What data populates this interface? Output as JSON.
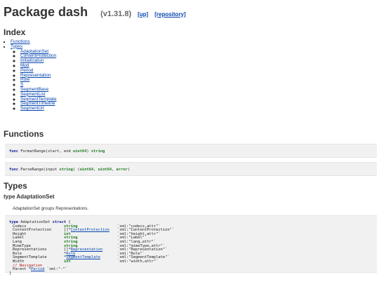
{
  "header": {
    "title": "Package dash",
    "version": "(v1.31.8)",
    "up_link": "[up]",
    "repo_link": "[repository]"
  },
  "index": {
    "heading": "Index",
    "functions_link": "Functions",
    "types_link": "Types",
    "types": [
      "AdaptationSet",
      "ContentProtection",
      "Initialization",
      "Mpd",
      "Period",
      "Representation",
      "Role",
      "S",
      "SegmentBase",
      "SegmentList",
      "SegmentTemplate",
      "SegmentTimeline",
      "SegmentUrl"
    ]
  },
  "functions": {
    "heading": "Functions",
    "format_range": {
      "kw": "func",
      "sig": " FormatRange(start, end ",
      "ptype": "uint64",
      "mid": ") ",
      "rtype": "string"
    },
    "parse_range": {
      "kw": "func",
      "sig": " ParseRange(input ",
      "ptype": "string",
      "mid": ") (",
      "r1": "uint64",
      "sep1": ", ",
      "r2": "uint64",
      "sep2": ", ",
      "r3": "error",
      "end": ")"
    }
  },
  "types_section": {
    "heading": "Types",
    "type_heading": "type AdaptationSet",
    "description": "AdaptationSet groups Representations.",
    "decl": {
      "kw1": "type",
      "name": " AdaptationSet ",
      "kw2": "struct",
      "open": " {",
      "fields": [
        {
          "name": "Codecs",
          "prefix": "",
          "type": "string",
          "type_style": "ty",
          "tag": "`xml:\"codecs,attr\"`"
        },
        {
          "name": "ContentProtection",
          "prefix": "[]*",
          "type": "ContentProtection",
          "type_style": "lnk",
          "tag": "`xml:\"ContentProtection\"`"
        },
        {
          "name": "Height",
          "prefix": "",
          "type": "int",
          "type_style": "ty",
          "tag": "`xml:\"height,attr\"`"
        },
        {
          "name": "Label",
          "prefix": "",
          "type": "string",
          "type_style": "ty",
          "tag": "`xml:\"Label\"`"
        },
        {
          "name": "Lang",
          "prefix": "",
          "type": "string",
          "type_style": "ty",
          "tag": "`xml:\"lang,attr\"`"
        },
        {
          "name": "MimeType",
          "prefix": "",
          "type": "string",
          "type_style": "ty",
          "tag": "`xml:\"mimeType,attr\"`"
        },
        {
          "name": "Representations",
          "prefix": "[]*",
          "type": "Representation",
          "type_style": "lnk",
          "tag": "`xml:\"Representation\"`"
        },
        {
          "name": "Role",
          "prefix": "*",
          "type": "Role",
          "type_style": "lnk",
          "tag": "`xml:\"Role\"`"
        },
        {
          "name": "SegmentTemplate",
          "prefix": "*",
          "type": "SegmentTemplate",
          "type_style": "lnk",
          "tag": "`xml:\"SegmentTemplate\"`"
        },
        {
          "name": "Width",
          "prefix": "",
          "type": "int",
          "type_style": "ty",
          "tag": "`xml:\"width,attr\"`"
        }
      ],
      "comment": "// Navigation",
      "parent_name": "Parent *",
      "parent_type": "Period",
      "parent_tag": " `xml:\"-\"`",
      "close": "}"
    }
  }
}
